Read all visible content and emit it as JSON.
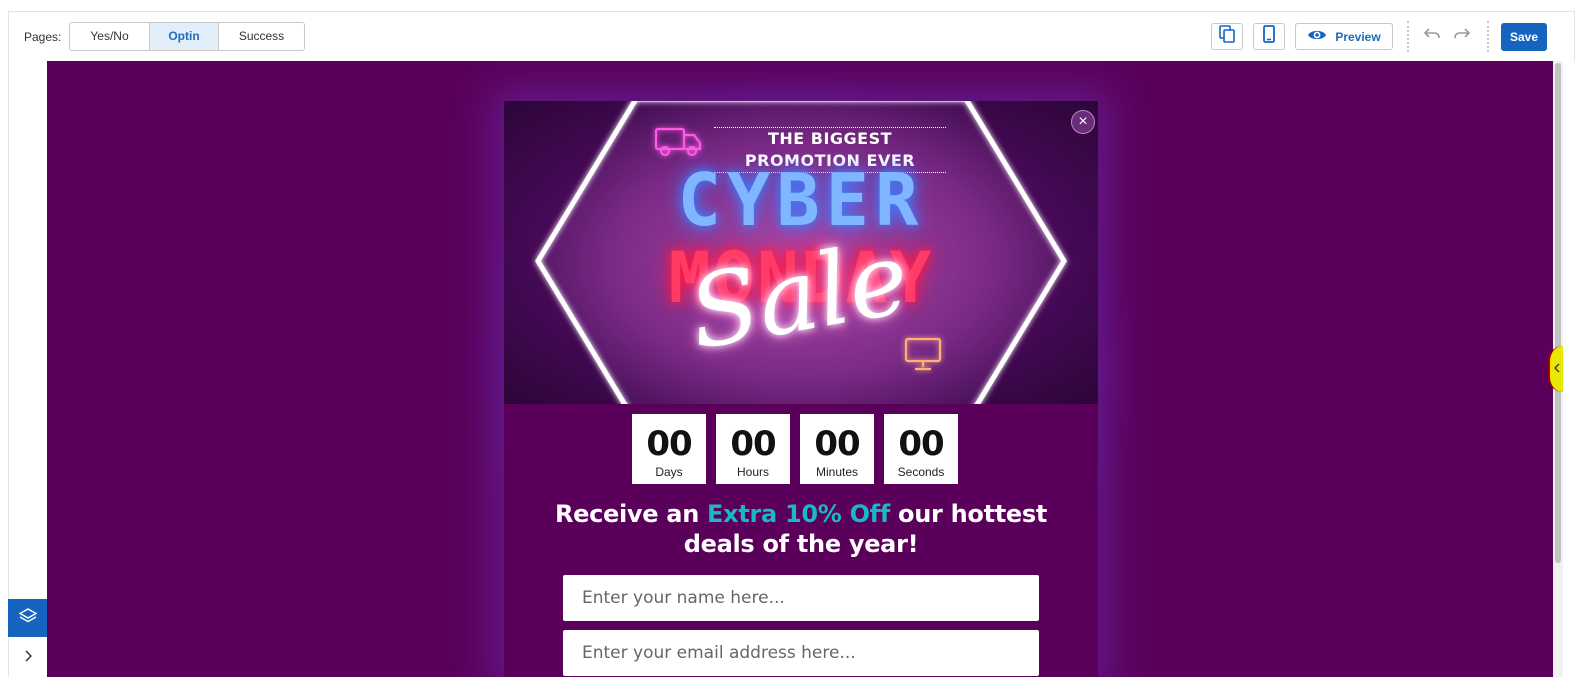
{
  "toolbar": {
    "pages_label": "Pages:",
    "pages": [
      {
        "label": "Yes/No",
        "active": false
      },
      {
        "label": "Optin",
        "active": true
      },
      {
        "label": "Success",
        "active": false
      }
    ],
    "preview_label": "Preview",
    "save_label": "Save",
    "icons": [
      "copy-icon",
      "mobile-icon",
      "eye-icon",
      "undo-icon",
      "redo-icon"
    ]
  },
  "sidebar": {
    "icons": [
      "layers-icon",
      "chevron-right-icon"
    ]
  },
  "popup": {
    "banner": {
      "tagline": "THE BIGGEST PROMOTION EVER",
      "line1": "CYBER",
      "line2": "MONDAY",
      "script": "Sale"
    },
    "close_symbol": "×",
    "countdown": [
      {
        "value": "00",
        "label": "Days"
      },
      {
        "value": "00",
        "label": "Hours"
      },
      {
        "value": "00",
        "label": "Minutes"
      },
      {
        "value": "00",
        "label": "Seconds"
      }
    ],
    "headline": {
      "part1": "Receive an ",
      "accent": "Extra 10% Off",
      "part2": " our hottest",
      "line2": "deals of the year!"
    },
    "name_placeholder": "Enter your name here...",
    "email_placeholder": "Enter your email address here..."
  },
  "colors": {
    "canvas_bg": "#5a005a",
    "accent_teal": "#19b8c6",
    "brand_blue": "#1565c0",
    "active_tab_bg": "#e2effa"
  }
}
